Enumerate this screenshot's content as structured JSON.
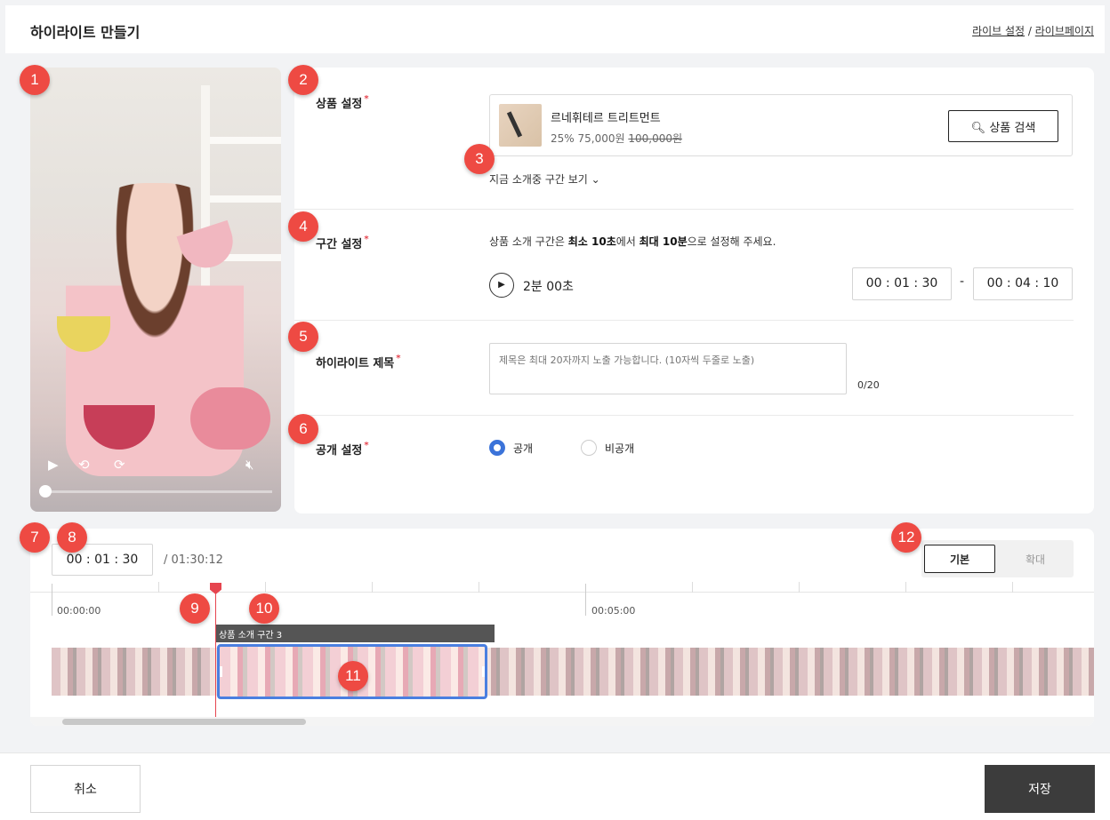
{
  "header": {
    "title": "하이라이트 만들기",
    "link_live_settings": "라이브 설정",
    "link_separator": " / ",
    "link_live_page": "라이브페이지"
  },
  "video": {
    "play_icon": "▶",
    "rewind_icon": "⟲",
    "forward_icon": "⟳",
    "mute_icon": "🔇︎",
    "progress": 0
  },
  "form": {
    "product_label": "상품 설정",
    "required_mark": "*",
    "product_name": "르네휘테르 트리트먼트",
    "product_discount_price": "25% 75,000원",
    "product_original_price": "100,000원",
    "search_button": "상품 검색",
    "search_icon": "🔍︎",
    "toggle_section": "지금 소개중 구간 보기",
    "chevron_icon": "⌄",
    "section_label": "구간 설정",
    "hint_prefix": "상품 소개 구간은 ",
    "hint_min": "최소 10초",
    "hint_mid": "에서 ",
    "hint_max": "최대 10분",
    "hint_suffix": "으로 설정해 주세요.",
    "duration": "2분 00초",
    "start_time": "00 : 01 : 30",
    "time_dash": "-",
    "end_time": "00 : 04 : 10",
    "title_label": "하이라이트 제목",
    "title_placeholder": "제목은 최대 20자까지 노출 가능합니다. (10자씩 두줄로 노출)",
    "title_count": "0/20",
    "visibility_label": "공개 설정",
    "visibility_public": "공개",
    "visibility_private": "비공개",
    "visibility_selected": "공개"
  },
  "timeline": {
    "current_time": "00 : 01 : 30",
    "total_time": "/  01:30:12",
    "zoom_basic": "기본",
    "zoom_expand": "확대",
    "tick_start": "00:00:00",
    "tick_mid": "00:05:00",
    "segment_label": "상품 소개 구간 3"
  },
  "footer": {
    "cancel": "취소",
    "save": "저장"
  },
  "markers": [
    "1",
    "2",
    "3",
    "4",
    "5",
    "6",
    "7",
    "8",
    "9",
    "10",
    "11",
    "12"
  ],
  "colors": {
    "accent": "#3b73d9",
    "marker": "#ee4a43",
    "playhead": "#e6454f",
    "save_button": "#3c3c3c"
  }
}
